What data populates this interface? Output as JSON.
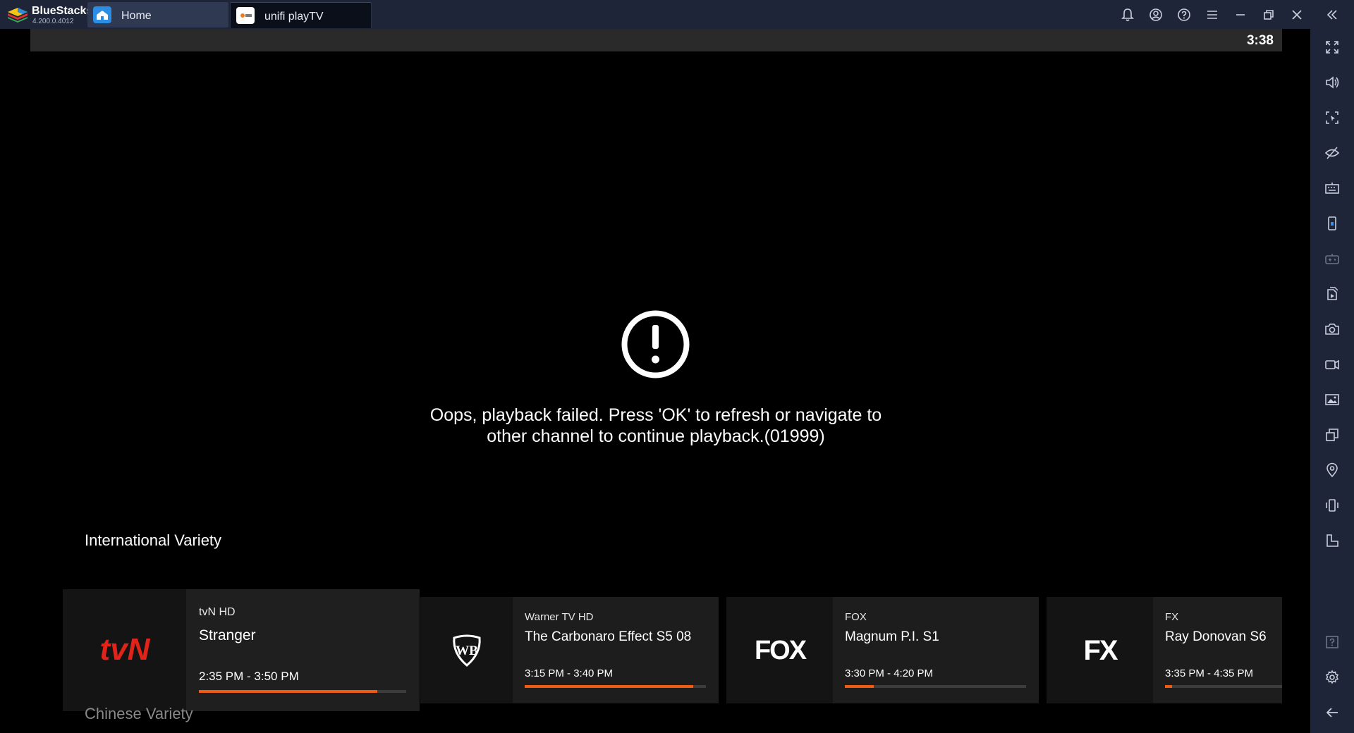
{
  "titlebar": {
    "app_name": "BlueStacks",
    "version": "4.200.0.4012",
    "tabs": [
      {
        "label": "Home",
        "icon": "home-icon"
      },
      {
        "label": "unifi playTV",
        "icon": "unifi-playtv-app-icon"
      }
    ],
    "controls": [
      "bell-icon",
      "account-icon",
      "help-icon",
      "menu-icon",
      "minimize-icon",
      "restore-icon",
      "close-icon",
      "collapse-sidebar-icon"
    ]
  },
  "sidebar": {
    "icons": [
      "fullscreen-icon",
      "volume-icon",
      "pointer-lock-icon",
      "eye-off-icon",
      "keyboard-icon",
      "phone-icon",
      "gamepad-icon",
      "install-apk-icon",
      "screenshot-icon",
      "record-icon",
      "media-folder-icon",
      "multi-instance-icon",
      "location-icon",
      "shake-icon",
      "rotate-icon",
      "help-icon",
      "settings-icon",
      "back-icon"
    ]
  },
  "player": {
    "clock": "3:38",
    "error_icon": "exclamation-circle-icon",
    "error_line1": "Oops, playback failed. Press 'OK' to refresh or navigate to",
    "error_line2": "other channel to continue playback.(01999)"
  },
  "sections": [
    {
      "title": "International Variety"
    },
    {
      "title": "Chinese Variety"
    }
  ],
  "channels": [
    {
      "channel": "tvN HD",
      "logo_text": "tvN",
      "program": "Stranger",
      "time": "2:35 PM - 3:50 PM",
      "progress": 0.86
    },
    {
      "channel": "Warner TV HD",
      "logo_text": "WB",
      "program": "The Carbonaro Effect S5 08",
      "time": "3:15 PM - 3:40 PM",
      "progress": 0.93
    },
    {
      "channel": "FOX",
      "logo_text": "FOX",
      "program": "Magnum P.I. S1",
      "time": "3:30 PM - 4:20 PM",
      "progress": 0.16
    },
    {
      "channel": "FX",
      "logo_text": "FX",
      "program": "Ray Donovan S6",
      "time": "3:35 PM - 4:35 PM",
      "progress": 0.06
    }
  ],
  "colors": {
    "accent": "#ef5a14",
    "tvn_red": "#e2231a",
    "chrome": "#1e2538"
  }
}
